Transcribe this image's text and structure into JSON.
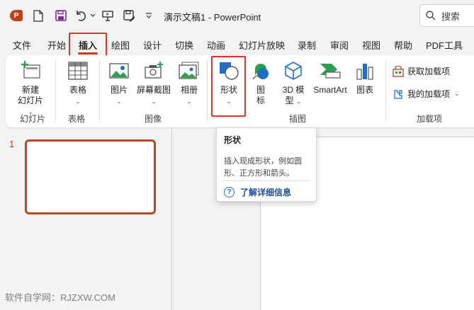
{
  "titlebar": {
    "app_logo": "P",
    "doc_title": "演示文稿1  -  PowerPoint",
    "search_placeholder": "搜索"
  },
  "tabs": [
    "文件",
    "开始",
    "插入",
    "绘图",
    "设计",
    "切换",
    "动画",
    "幻灯片放映",
    "录制",
    "审阅",
    "视图",
    "帮助",
    "PDF工具"
  ],
  "active_tab": "插入",
  "ribbon": {
    "new_slide_line1": "新建",
    "new_slide_line2": "幻灯片",
    "group_slides": "幻灯片",
    "table": "表格",
    "group_tables": "表格",
    "picture": "图片",
    "screenshot": "屏幕截图",
    "album": "相册",
    "group_images": "图像",
    "shapes": "形状",
    "icons_line1": "图",
    "icons_line2": "标",
    "model_line1": "3D 模",
    "model_line2": "型",
    "smartart": "SmartArt",
    "chart": "图表",
    "group_illustrations": "插图",
    "get_addins": "获取加载项",
    "my_addins": "我的加载项",
    "group_addins": "加载项"
  },
  "tooltip": {
    "title": "形状",
    "desc_line1": "插入现成形状，例如圆",
    "desc_line2": "形、正方形和箭头。",
    "link": "了解详细信息"
  },
  "slides": {
    "number": "1"
  },
  "watermark": "软件自学网：RJZXW.COM",
  "colors": {
    "accent": "#c43e1c",
    "highlight_box": "#e0312b",
    "link": "#1f4e9a"
  }
}
